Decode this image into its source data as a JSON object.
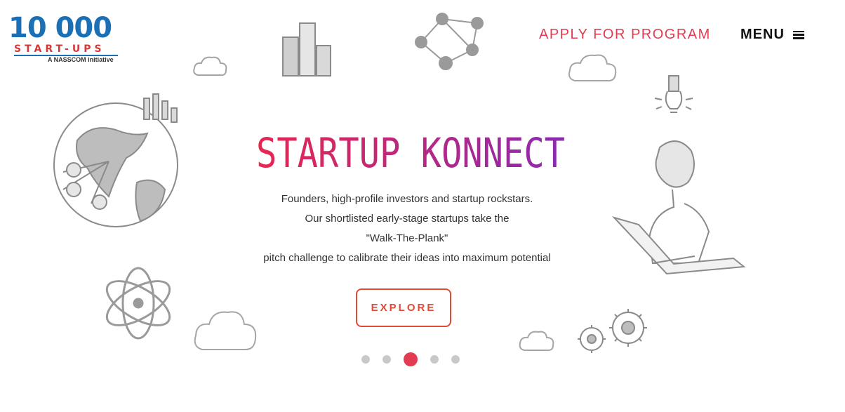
{
  "logo": {
    "number": "10 000",
    "wordmark": "START-UPS",
    "tagline": "A NASSCOM initiative"
  },
  "nav": {
    "apply_label": "APPLY FOR PROGRAM",
    "menu_label": "MENU"
  },
  "hero": {
    "title": "STARTUP KONNECT",
    "lines": [
      "Founders, high-profile investors and startup rockstars.",
      "Our shortlisted early-stage startups take the",
      "\"Walk-The-Plank\"",
      "pitch challenge to calibrate their ideas into maximum potential"
    ],
    "cta_label": "EXPLORE"
  },
  "carousel": {
    "slide_count": 5,
    "active_index": 2
  },
  "colors": {
    "accent": "#e23c53",
    "cta": "#e04a36",
    "title_start": "#e8264f",
    "title_end": "#8a2ab0",
    "logo_blue": "#1a6fb5",
    "doodle": "#9a9a9a"
  }
}
